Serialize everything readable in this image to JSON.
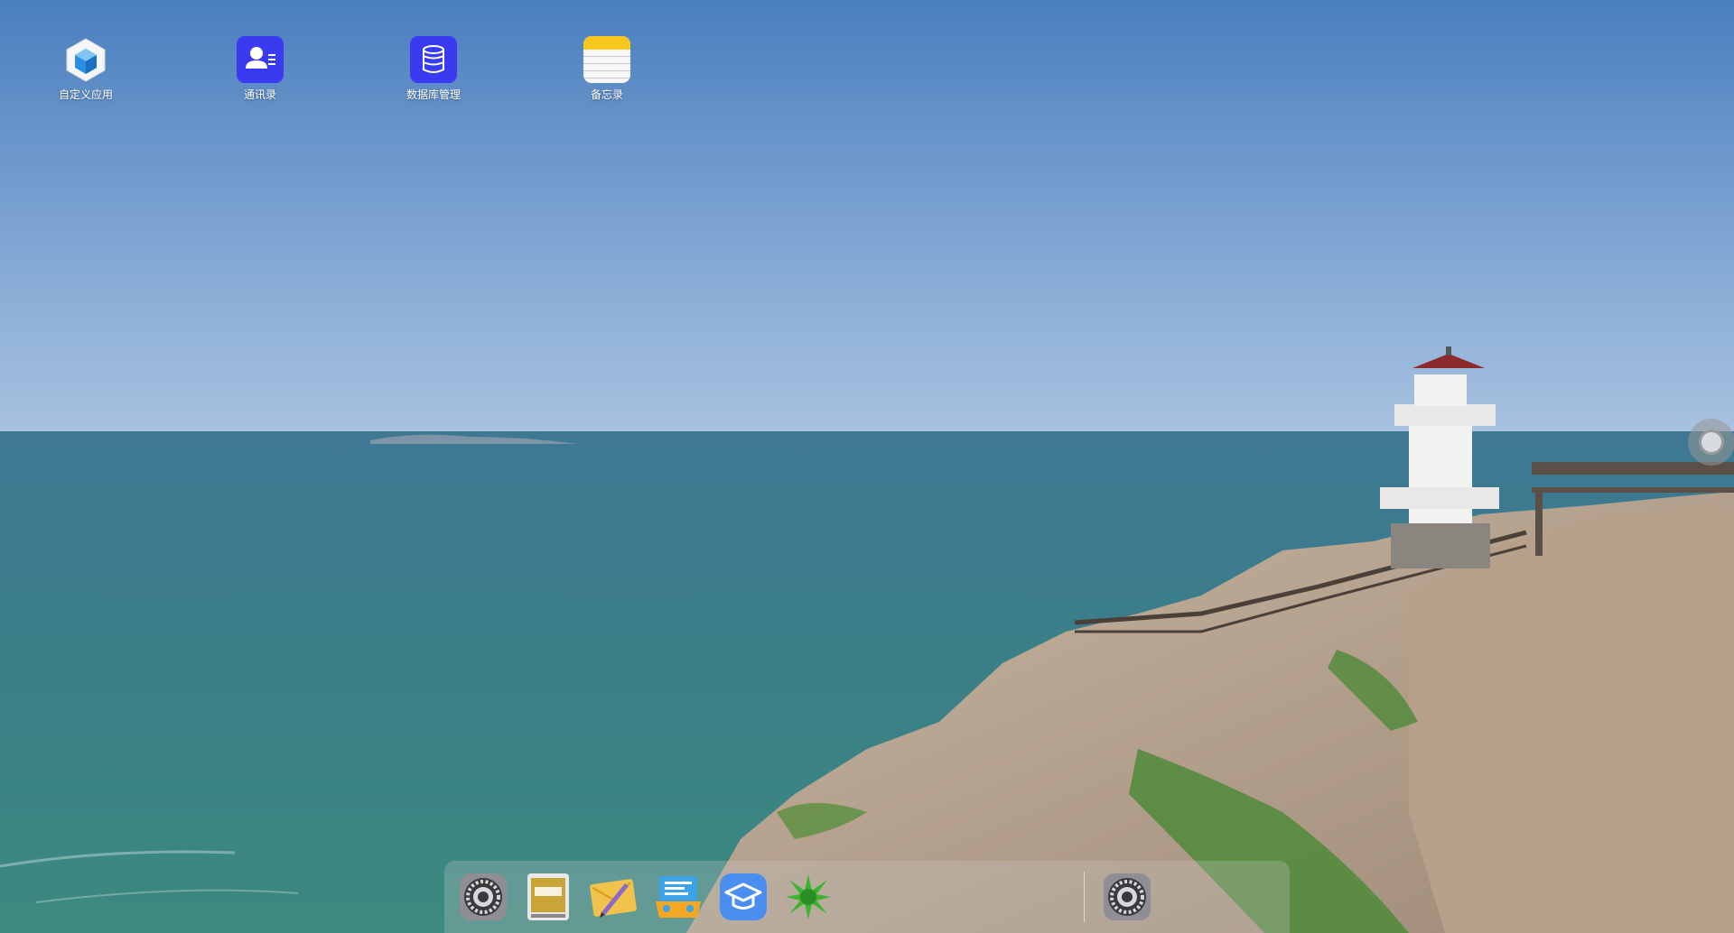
{
  "desktop": {
    "icons": [
      {
        "label": "自定义应用",
        "icon": "cube-icon"
      },
      {
        "label": "通讯录",
        "icon": "contacts-icon"
      },
      {
        "label": "数据库管理",
        "icon": "database-icon"
      },
      {
        "label": "备忘录",
        "icon": "notes-icon"
      }
    ]
  },
  "dock": {
    "items": [
      {
        "icon": "settings-gear-icon"
      },
      {
        "icon": "mac-app-icon"
      },
      {
        "icon": "envelope-pen-icon"
      },
      {
        "icon": "message-board-icon"
      },
      {
        "icon": "graduation-cap-icon"
      },
      {
        "icon": "green-star-icon"
      },
      {
        "icon": "settings-gear-icon"
      }
    ]
  },
  "colors": {
    "accent_blue": "#3a3af0",
    "notes_yellow": "#f7c81e",
    "cap_blue": "#4a8ef2"
  }
}
